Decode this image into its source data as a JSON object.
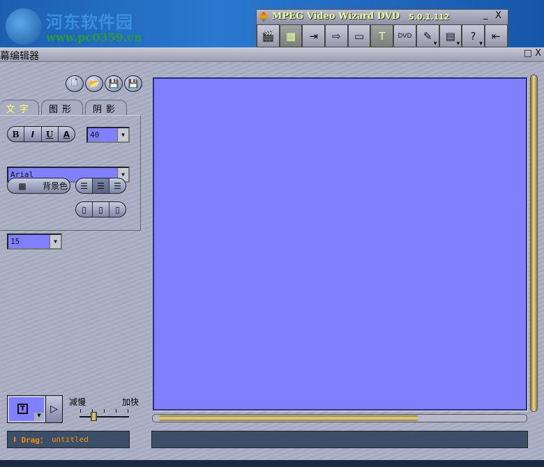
{
  "banner": {
    "logo_text": "河东软件园",
    "logo_url": "www.pc0359.cn"
  },
  "toolbar": {
    "title": "MPEG Video Wizard DVD",
    "version": "5.0.1.112",
    "minimize": "_",
    "close": "X",
    "buttons": [
      {
        "name": "clapper",
        "glyph": "🎬"
      },
      {
        "name": "timeline",
        "glyph": "▦"
      },
      {
        "name": "import",
        "glyph": "⇥"
      },
      {
        "name": "export",
        "glyph": "⇨"
      },
      {
        "name": "tape",
        "glyph": "▭"
      },
      {
        "name": "text-editor",
        "glyph": "T"
      },
      {
        "name": "dvd",
        "glyph": "DVD"
      },
      {
        "name": "tools",
        "glyph": "✎"
      },
      {
        "name": "layout",
        "glyph": "▤"
      },
      {
        "name": "help",
        "glyph": "?"
      },
      {
        "name": "exit",
        "glyph": "⇤"
      }
    ]
  },
  "panel": {
    "title": "幕编辑器",
    "restore": "□",
    "close": "X"
  },
  "file_buttons": [
    "new",
    "open",
    "save",
    "save-as"
  ],
  "tabs": [
    {
      "label": "文字",
      "active": true
    },
    {
      "label": "图形"
    },
    {
      "label": "阴影"
    }
  ],
  "text": {
    "bold": "B",
    "italic": "I",
    "underline": "U",
    "color": "A",
    "font_size": "40",
    "font": "Arial",
    "bg_color_label": "背景色",
    "line_size": "15",
    "align_active": "center",
    "valign_active": "top"
  },
  "speed": {
    "slow_label": "减慢",
    "fast_label": "加快",
    "value_fraction": 0.25
  },
  "hscroll_fraction": 0.72,
  "status": {
    "drag_label": "Drag：",
    "drag_value": "untitled"
  },
  "colors": {
    "canvas": "#8080ff",
    "accent": "#ff8a00"
  }
}
